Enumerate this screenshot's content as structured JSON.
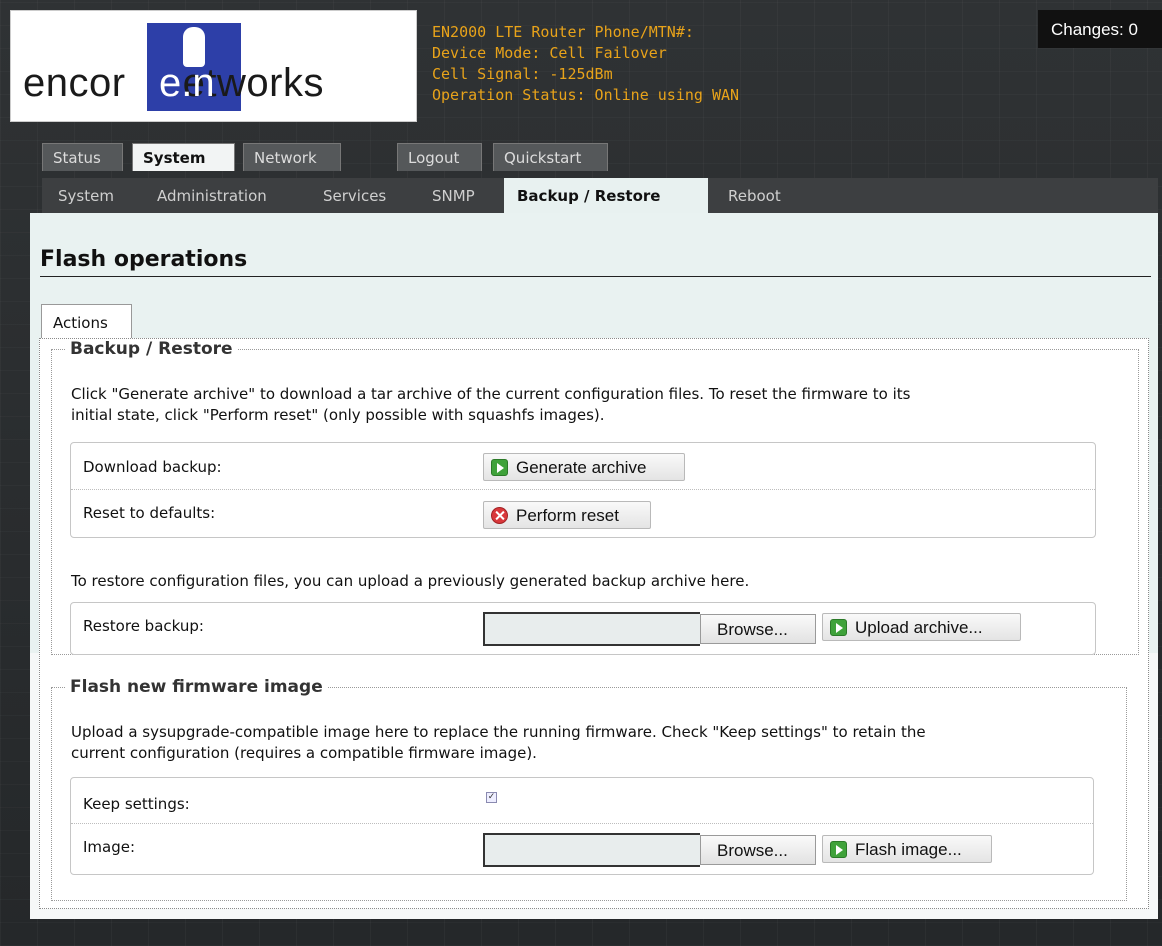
{
  "header": {
    "logo_text_left": "encor",
    "logo_text_mid": "e.n",
    "logo_text_right": "etworks",
    "info_lines": [
      "EN2000 LTE Router Phone/MTN#:",
      "Device Mode: Cell Failover",
      "Cell Signal: -125dBm",
      "Operation Status: Online using WAN"
    ],
    "changes_label": "Changes: 0"
  },
  "nav": {
    "main_tabs": [
      "Status",
      "System",
      "Network",
      "Logout",
      "Quickstart"
    ],
    "active_main": "System",
    "sub_tabs": [
      "System",
      "Administration",
      "Services",
      "SNMP",
      "Backup / Restore",
      "Reboot"
    ],
    "active_sub": "Backup / Restore"
  },
  "page": {
    "title": "Flash operations",
    "tab_label": "Actions"
  },
  "backup": {
    "legend": "Backup / Restore",
    "description_1": "Click \"Generate archive\" to download a tar archive of the current configuration files. To reset the firmware to its",
    "description_2": "initial state, click \"Perform reset\" (only possible with squashfs images).",
    "download_label": "Download backup:",
    "generate_button": "Generate archive",
    "reset_label": "Reset to defaults:",
    "reset_button": "Perform reset",
    "restore_text": "To restore configuration files, you can upload a previously generated backup archive here.",
    "restore_label": "Restore backup:",
    "browse_button": "Browse...",
    "upload_button": "Upload archive..."
  },
  "firmware": {
    "legend": "Flash new firmware image",
    "description_1": "Upload a sysupgrade-compatible image here to replace the running firmware. Check \"Keep settings\" to retain the",
    "description_2": "current configuration (requires a compatible firmware image).",
    "keep_label": "Keep settings:",
    "keep_checked": true,
    "image_label": "Image:",
    "browse_button": "Browse...",
    "flash_button": "Flash image..."
  },
  "colors": {
    "header_info": "#e8a31a",
    "logo_blue": "#2d3fa8",
    "panel_bg": "#e9f2f1",
    "go_icon": "#3fa23a",
    "reset_icon": "#d9383b"
  }
}
